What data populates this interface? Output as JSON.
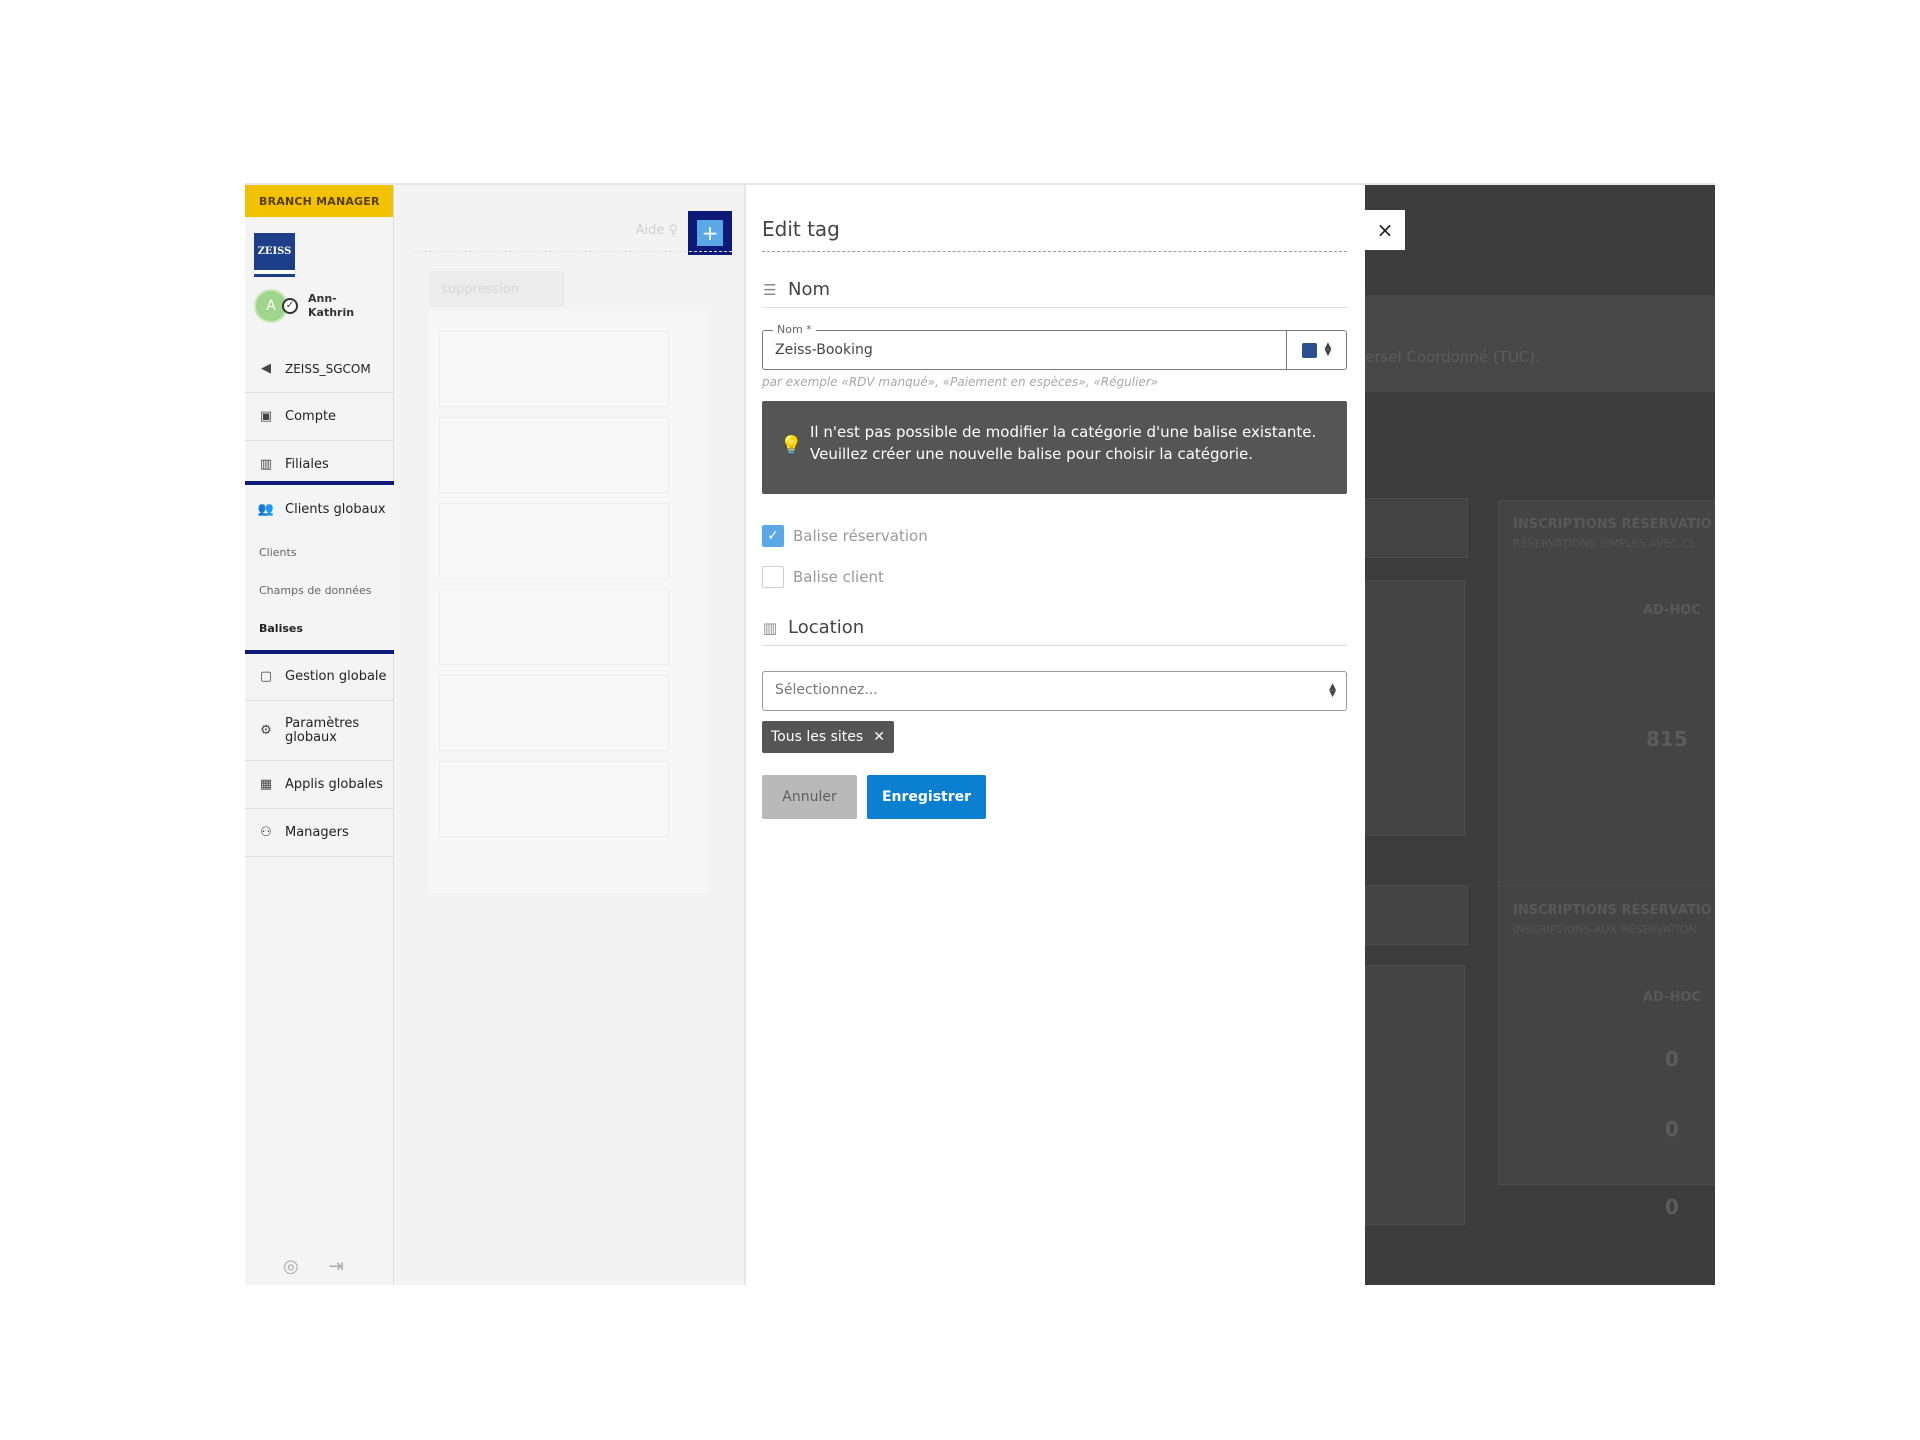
{
  "sidebar": {
    "role": "BRANCH MANAGER",
    "logo_text": "ZEISS",
    "user": {
      "initial": "A",
      "name": "Ann-Kathrin"
    },
    "items": [
      {
        "label": "ZEISS_SGCOM",
        "icon": "back-circle-icon"
      },
      {
        "label": "Compte",
        "icon": "briefcase-icon"
      },
      {
        "label": "Filiales",
        "icon": "building-icon"
      }
    ],
    "group": {
      "label": "Clients globaux",
      "icon": "users-icon",
      "subitems": [
        {
          "label": "Clients"
        },
        {
          "label": "Champs de données"
        },
        {
          "label": "Balises"
        }
      ]
    },
    "items_after": [
      {
        "label": "Gestion globale",
        "icon": "suitcase-icon"
      },
      {
        "label": "Paramètres globaux",
        "icon": "gears-icon"
      },
      {
        "label": "Applis globales",
        "icon": "grid-icon"
      },
      {
        "label": "Managers",
        "icon": "manager-icon"
      }
    ]
  },
  "mid": {
    "help_label": "Aide",
    "plus_label": "+",
    "ghost_tab": "suppression"
  },
  "modal": {
    "title": "Edit tag",
    "name_section": "Nom",
    "name_field": {
      "label": "Nom *",
      "value": "Zeiss-Booking",
      "color": "#2c4f8e"
    },
    "hint": "par exemple «RDV manqué», «Paiement en espèces», «Régulier»",
    "info": "Il n'est pas possible de modifier la catégorie d'une balise existante. Veuillez créer une nouvelle balise pour choisir la catégorie.",
    "checkboxes": [
      {
        "label": "Balise réservation",
        "checked": true
      },
      {
        "label": "Balise client",
        "checked": false
      }
    ],
    "location_section": "Location",
    "select_placeholder": "Sélectionnez...",
    "chip": "Tous les sites",
    "cancel": "Annuler",
    "save": "Enregistrer",
    "close": "×"
  },
  "background": {
    "band_text": "ersel Coordonné (TUC).",
    "card1_title": "INSCRIPTIONS RÉSERVATIO",
    "card1_sub": "RÉSERVATIONS SIMPLES AVEC CL",
    "card1_label": "AD-HOC",
    "card1_value": "815",
    "card2_title": "INSCRIPTIONS RÉSERVATIO",
    "card2_sub": "INSCRIPTIONS AUX RÉSERVATION",
    "card2_label": "AD-HOC",
    "card2_values": [
      "0",
      "0",
      "0"
    ]
  }
}
